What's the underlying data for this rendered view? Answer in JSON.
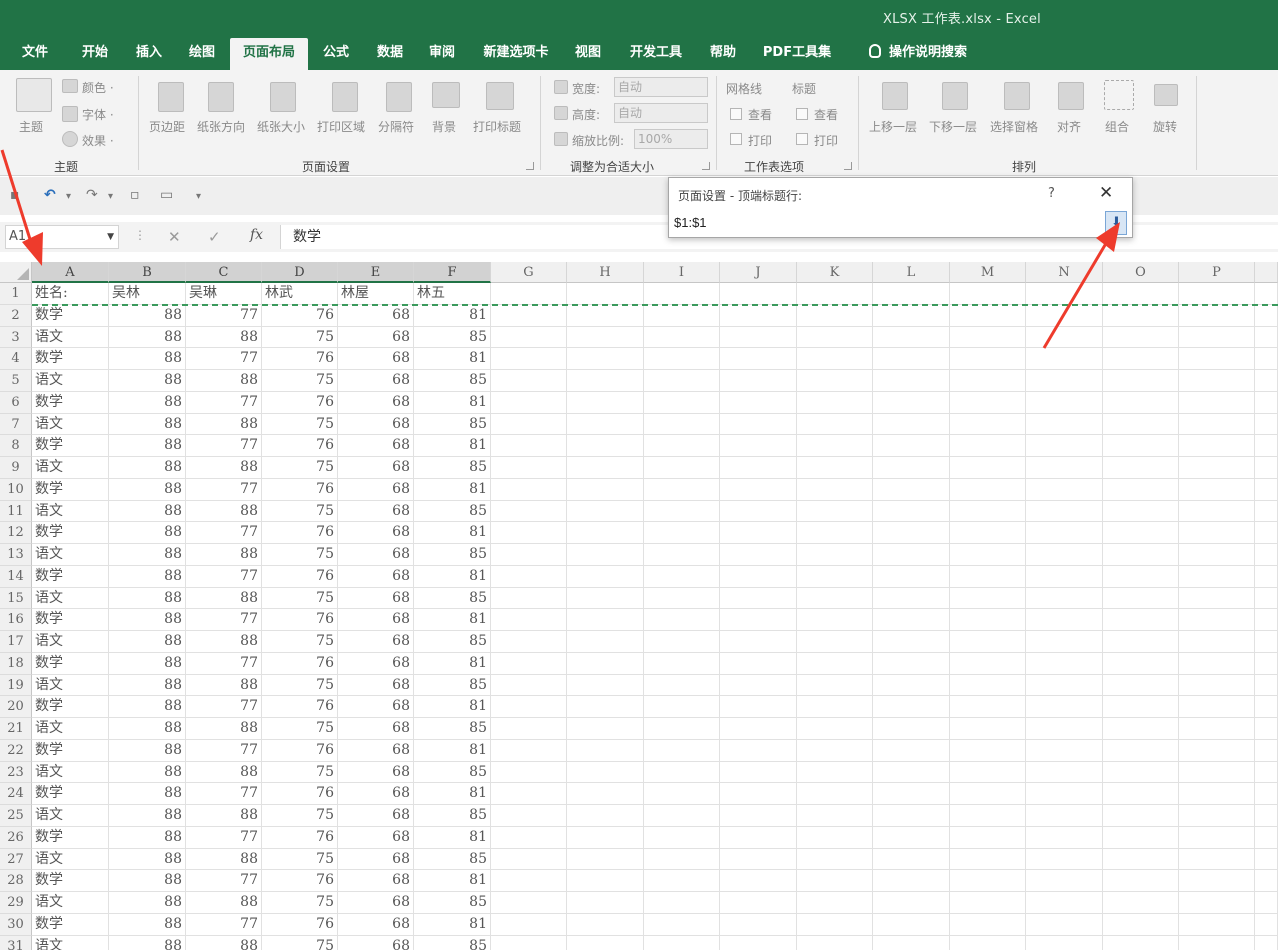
{
  "window": {
    "title": "XLSX 工作表.xlsx  -  Excel"
  },
  "tabs": [
    {
      "label": "文件",
      "active": false
    },
    {
      "label": "开始",
      "active": false
    },
    {
      "label": "插入",
      "active": false
    },
    {
      "label": "绘图",
      "active": false
    },
    {
      "label": "页面布局",
      "active": true
    },
    {
      "label": "公式",
      "active": false
    },
    {
      "label": "数据",
      "active": false
    },
    {
      "label": "审阅",
      "active": false
    },
    {
      "label": "新建选项卡",
      "active": false
    },
    {
      "label": "视图",
      "active": false
    },
    {
      "label": "开发工具",
      "active": false
    },
    {
      "label": "帮助",
      "active": false
    },
    {
      "label": "PDF工具集",
      "active": false
    },
    {
      "label": "操作说明搜索",
      "active": false
    }
  ],
  "ribbon": {
    "theme": {
      "main": "主题",
      "colors": "颜色 ·",
      "fonts": "字体 ·",
      "effects": "效果 ·",
      "group": "主题"
    },
    "page_setup": {
      "items": [
        "页边距",
        "纸张方向",
        "纸张大小",
        "打印区域",
        "分隔符",
        "背景",
        "打印标题"
      ],
      "group": "页面设置"
    },
    "scale": {
      "width_label": "宽度:",
      "width_value": "自动",
      "height_label": "高度:",
      "height_value": "自动",
      "scale_label": "缩放比例:",
      "scale_value": "100%",
      "group": "调整为合适大小"
    },
    "sheet_options": {
      "gridlines": "网格线",
      "headings": "标题",
      "view": "查看",
      "print": "打印",
      "group": "工作表选项"
    },
    "arrange": {
      "items": [
        "上移一层",
        "下移一层",
        "选择窗格",
        "对齐",
        "组合",
        "旋转"
      ],
      "group": "排列"
    }
  },
  "formula_bar": {
    "name_box": "A1",
    "fx": "fx",
    "value": "数学"
  },
  "dialog": {
    "title": "页面设置 - 顶端标题行:",
    "help": "?",
    "close": "✕",
    "value": "$1:$1"
  },
  "sheet": {
    "columns": [
      "A",
      "B",
      "C",
      "D",
      "E",
      "F",
      "G",
      "H",
      "I",
      "J",
      "K",
      "L",
      "M",
      "N",
      "O",
      "P"
    ],
    "header_row": [
      "姓名:",
      "吴林",
      "吴琳",
      "林武",
      "林屋",
      "林五"
    ],
    "row_numbers": [
      "1",
      "2",
      "3",
      "4",
      "5",
      "6",
      "7",
      "8",
      "9",
      "10",
      "11",
      "12",
      "13",
      "14",
      "15",
      "16",
      "17",
      "18",
      "19",
      "20",
      "21",
      "22",
      "23",
      "24",
      "25",
      "26",
      "27",
      "28",
      "29",
      "30",
      "31"
    ],
    "data_rows": [
      [
        "数学",
        "88",
        "77",
        "76",
        "68",
        "81"
      ],
      [
        "语文",
        "88",
        "88",
        "75",
        "68",
        "85"
      ],
      [
        "数学",
        "88",
        "77",
        "76",
        "68",
        "81"
      ],
      [
        "语文",
        "88",
        "88",
        "75",
        "68",
        "85"
      ],
      [
        "数学",
        "88",
        "77",
        "76",
        "68",
        "81"
      ],
      [
        "语文",
        "88",
        "88",
        "75",
        "68",
        "85"
      ],
      [
        "数学",
        "88",
        "77",
        "76",
        "68",
        "81"
      ],
      [
        "语文",
        "88",
        "88",
        "75",
        "68",
        "85"
      ],
      [
        "数学",
        "88",
        "77",
        "76",
        "68",
        "81"
      ],
      [
        "语文",
        "88",
        "88",
        "75",
        "68",
        "85"
      ],
      [
        "数学",
        "88",
        "77",
        "76",
        "68",
        "81"
      ],
      [
        "语文",
        "88",
        "88",
        "75",
        "68",
        "85"
      ],
      [
        "数学",
        "88",
        "77",
        "76",
        "68",
        "81"
      ],
      [
        "语文",
        "88",
        "88",
        "75",
        "68",
        "85"
      ],
      [
        "数学",
        "88",
        "77",
        "76",
        "68",
        "81"
      ],
      [
        "语文",
        "88",
        "88",
        "75",
        "68",
        "85"
      ],
      [
        "数学",
        "88",
        "77",
        "76",
        "68",
        "81"
      ],
      [
        "语文",
        "88",
        "88",
        "75",
        "68",
        "85"
      ],
      [
        "数学",
        "88",
        "77",
        "76",
        "68",
        "81"
      ],
      [
        "语文",
        "88",
        "88",
        "75",
        "68",
        "85"
      ],
      [
        "数学",
        "88",
        "77",
        "76",
        "68",
        "81"
      ],
      [
        "语文",
        "88",
        "88",
        "75",
        "68",
        "85"
      ],
      [
        "数学",
        "88",
        "77",
        "76",
        "68",
        "81"
      ],
      [
        "语文",
        "88",
        "88",
        "75",
        "68",
        "85"
      ],
      [
        "数学",
        "88",
        "77",
        "76",
        "68",
        "81"
      ],
      [
        "语文",
        "88",
        "88",
        "75",
        "68",
        "85"
      ],
      [
        "数学",
        "88",
        "77",
        "76",
        "68",
        "81"
      ],
      [
        "语文",
        "88",
        "88",
        "75",
        "68",
        "85"
      ],
      [
        "数学",
        "88",
        "77",
        "76",
        "68",
        "81"
      ],
      [
        "语文",
        "88",
        "88",
        "75",
        "68",
        "85"
      ]
    ]
  },
  "colors": {
    "brand": "#217346",
    "annotation": "#ee3b2c"
  }
}
